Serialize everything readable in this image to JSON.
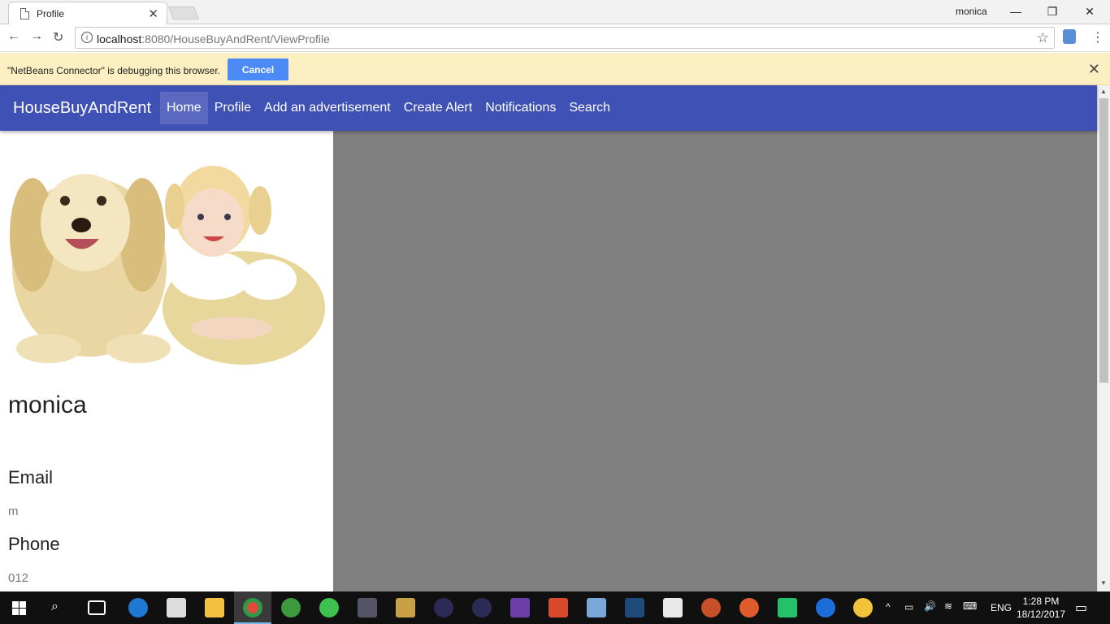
{
  "browser": {
    "tab_title": "Profile",
    "tab_close": "✕",
    "window_user": "monica",
    "url_host": "localhost",
    "url_rest": ":8080/HouseBuyAndRent/ViewProfile",
    "infobar_message": "\"NetBeans Connector\" is debugging this browser.",
    "infobar_cancel": "Cancel",
    "infobar_close": "✕"
  },
  "navbar": {
    "brand": "HouseBuyAndRent",
    "links": [
      "Home",
      "Profile",
      "Add an advertisement",
      "Create Alert",
      "Notifications",
      "Search"
    ],
    "active": "Home"
  },
  "profile": {
    "name": "monica",
    "email_label": "Email",
    "email_value": "m",
    "phone_label": "Phone",
    "phone_value": "012"
  },
  "taskbar": {
    "language": "ENG",
    "time": "1:28 PM",
    "date": "18/12/2017"
  }
}
